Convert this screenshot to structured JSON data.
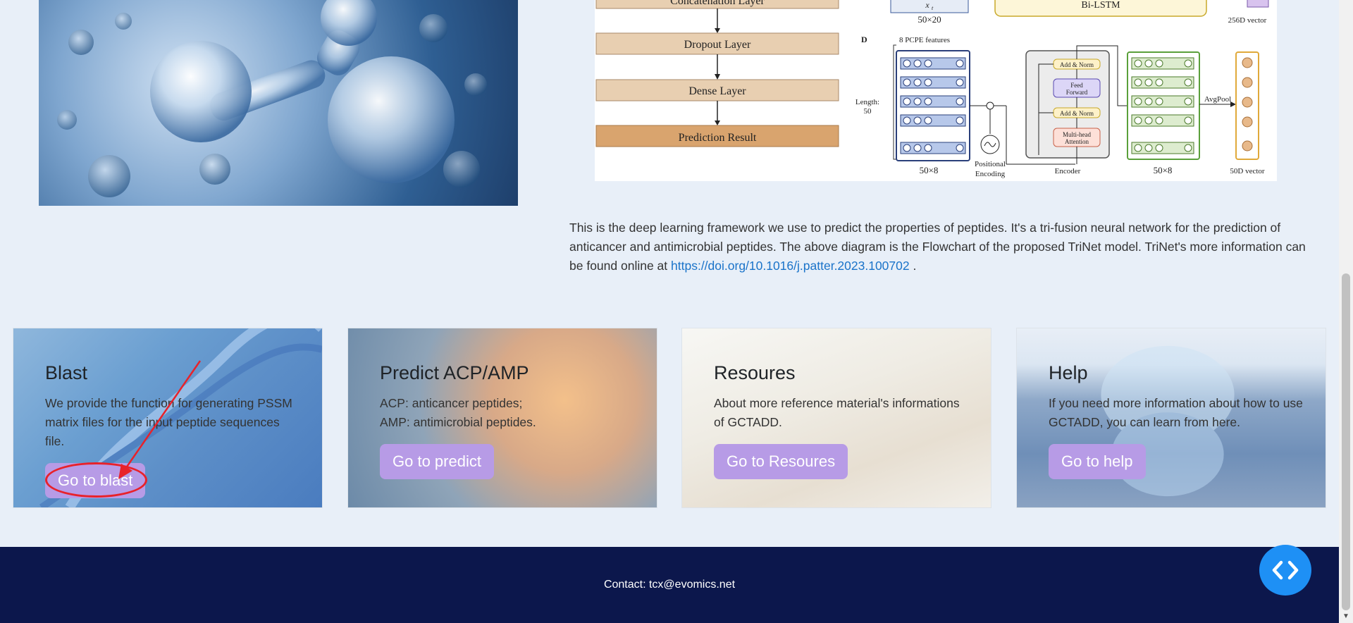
{
  "diagram": {
    "left_labels": [
      "Concatenation Layer",
      "Dropout Layer",
      "Dense Layer",
      "Prediction Result"
    ],
    "top_labels": {
      "x_label": "x",
      "x_sub": "t",
      "size_top": "50×20",
      "bilstm": "Bi-LSTM",
      "vec256": "256D vector"
    },
    "panel_d": {
      "letter": "D",
      "features": "8 PCPE features",
      "length": "Length:",
      "length_val": "50",
      "size_left": "50×8",
      "positional": "Positional",
      "encoding": "Encoding",
      "add_norm_1": "Add & Norm",
      "feed": "Feed",
      "forward": "Forward",
      "add_norm_2": "Add & Norm",
      "multi_head": "Multi-head",
      "attention": "Attention",
      "encoder": "Encoder",
      "size_right": "50×8",
      "avgpool": "AvgPool",
      "vec50": "50D vector"
    }
  },
  "description": {
    "text": "This is the deep learning framework we use to predict the properties of peptides. It's a tri-fusion neural network for the prediction of anticancer and antimicrobial peptides. The above diagram is the Flowchart of the proposed TriNet model. TriNet's more information can be found online at ",
    "link": "https://doi.org/10.1016/j.patter.2023.100702",
    "tail": " ."
  },
  "cards": [
    {
      "title": "Blast",
      "text": "We provide the function for generating PSSM matrix files for the input peptide sequences file.",
      "button": "Go to blast"
    },
    {
      "title": "Predict ACP/AMP",
      "line1": "ACP: anticancer peptides;",
      "line2": "AMP: antimicrobial peptides.",
      "button": "Go to predict"
    },
    {
      "title": "Resoures",
      "text": "About more reference material's informations of GCTADD.",
      "button": "Go to Resoures"
    },
    {
      "title": "Help",
      "text": "If you need more information about how to use GCTADD, you can learn from here.",
      "button": "Go to help"
    }
  ],
  "footer": {
    "contact": "Contact: tcx@evomics.net"
  },
  "fab_icon": "code-brackets-icon",
  "colors": {
    "accent_button": "#b79be6",
    "footer_bg": "#0c174c",
    "fab": "#1e90f5",
    "highlight": "#e8222a",
    "link": "#1a73c9"
  }
}
